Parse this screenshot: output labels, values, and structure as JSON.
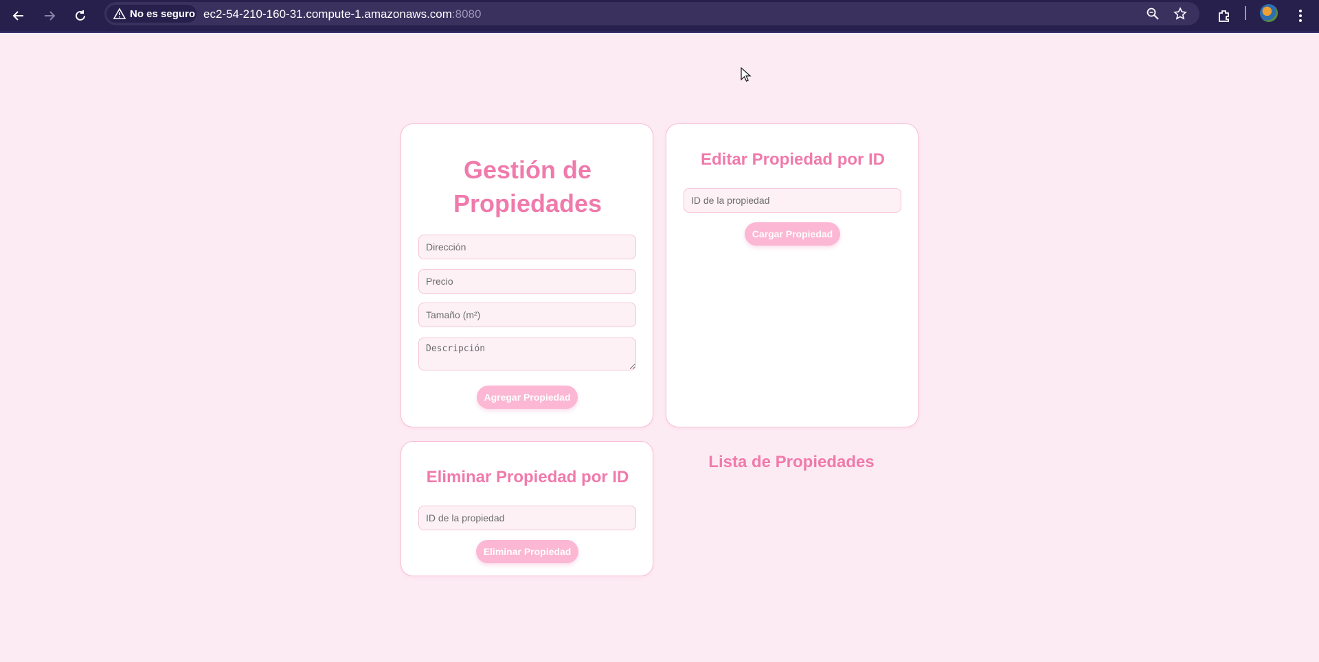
{
  "browser": {
    "security_label": "No es seguro",
    "url_host": "ec2-54-210-160-31.compute-1.amazonaws.com",
    "url_port": ":8080"
  },
  "add_card": {
    "title": "Gestión de Propiedades",
    "address_placeholder": "Dirección",
    "price_placeholder": "Precio",
    "size_placeholder": "Tamaño (m²)",
    "description_placeholder": "Descripción",
    "button_label": "Agregar Propiedad"
  },
  "edit_card": {
    "title": "Editar Propiedad por ID",
    "id_placeholder": "ID de la propiedad",
    "button_label": "Cargar Propiedad"
  },
  "delete_card": {
    "title": "Eliminar Propiedad por ID",
    "id_placeholder": "ID de la propiedad",
    "button_label": "Eliminar Propiedad"
  },
  "list": {
    "title": "Lista de Propiedades"
  },
  "colors": {
    "page_background": "#fdebf3",
    "accent": "#f07aab",
    "button": "#fbb7d3",
    "chrome": "#28204c"
  },
  "icons": [
    "back-arrow-icon",
    "forward-arrow-icon",
    "reload-icon",
    "warning-icon",
    "zoom-icon",
    "star-icon",
    "extensions-icon",
    "menu-icon"
  ]
}
